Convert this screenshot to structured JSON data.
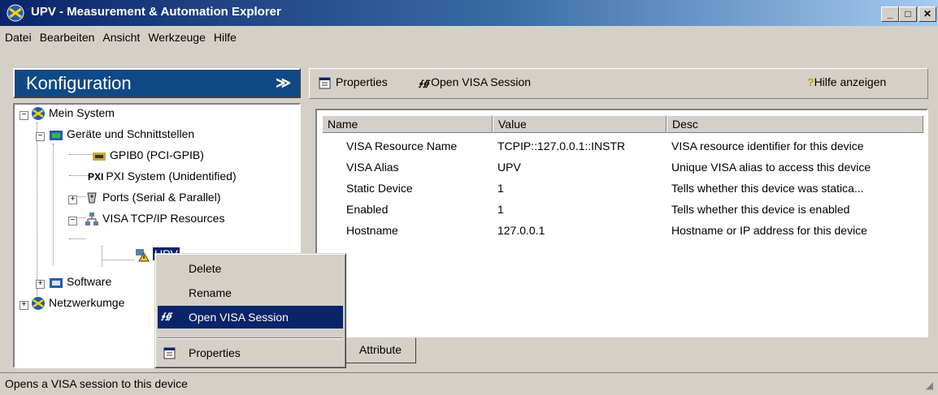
{
  "window": {
    "title": "UPV - Measurement & Automation Explorer",
    "minimize": "_",
    "maximize": "□",
    "close": "✕"
  },
  "menu": [
    "Datei",
    "Bearbeiten",
    "Ansicht",
    "Werkzeuge",
    "Hilfe"
  ],
  "left_panel": {
    "title": "Konfiguration",
    "chevron": "≫",
    "tree": [
      {
        "label": "Mein System",
        "icon": "system-globe-icon"
      },
      {
        "label": "Geräte und Schnittstellen",
        "icon": "folder-device-icon"
      },
      {
        "label": "GPIB0 (PCI-GPIB)",
        "icon": "gpib-card-icon"
      },
      {
        "label": "PXI System (Unidentified)",
        "icon": "pxi-icon"
      },
      {
        "label": "Ports (Serial & Parallel)",
        "icon": "port-icon"
      },
      {
        "label": "VISA TCP/IP Resources",
        "icon": "network-icon"
      },
      {
        "label": "UPV",
        "icon": "warning-network-icon"
      },
      {
        "label": "Software",
        "icon": "folder-software-icon"
      },
      {
        "label": "Netzwerkumge",
        "icon": "network-globe-icon"
      }
    ],
    "expanders": {
      "minus": "−",
      "plus": "+"
    }
  },
  "toolbar": {
    "properties": "Properties",
    "open_visa": "Open VISA Session",
    "help": "Hilfe anzeigen"
  },
  "table": {
    "columns": [
      "Name",
      "Value",
      "Desc"
    ],
    "rows": [
      [
        "VISA Resource Name",
        "TCPIP::127.0.0.1::INSTR",
        "VISA resource identifier for this device"
      ],
      [
        "VISA Alias",
        "UPV",
        "Unique VISA alias to access this device"
      ],
      [
        "Static Device",
        "1",
        "Tells whether this device was statica..."
      ],
      [
        "Enabled",
        "1",
        "Tells whether this device is enabled"
      ],
      [
        "Hostname",
        "127.0.0.1",
        "Hostname or IP address for this device"
      ]
    ]
  },
  "tabs": {
    "attribute": "Attribute"
  },
  "context_menu": {
    "delete": "Delete",
    "rename": "Rename",
    "open_visa": "Open VISA Session",
    "properties": "Properties"
  },
  "status": {
    "text": "Opens a VISA session to this device"
  },
  "colors": {
    "title_start": "#0a246a",
    "title_end": "#a6caf0",
    "panel_header": "#0f4a86",
    "selection": "#0a246a"
  }
}
